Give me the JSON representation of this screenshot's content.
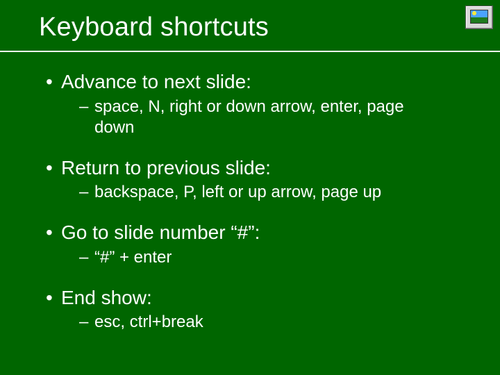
{
  "title": "Keyboard shortcuts",
  "items": [
    {
      "label": "Advance to next slide:",
      "sub": "space, N, right or down arrow, enter, page down"
    },
    {
      "label": "Return to previous slide:",
      "sub": "backspace, P, left or up arrow, page up"
    },
    {
      "label": "Go to slide number “#”:",
      "sub": "“#” + enter"
    },
    {
      "label": "End show:",
      "sub": "esc, ctrl+break"
    }
  ],
  "bullets": {
    "level1": "•",
    "level2": "–"
  }
}
